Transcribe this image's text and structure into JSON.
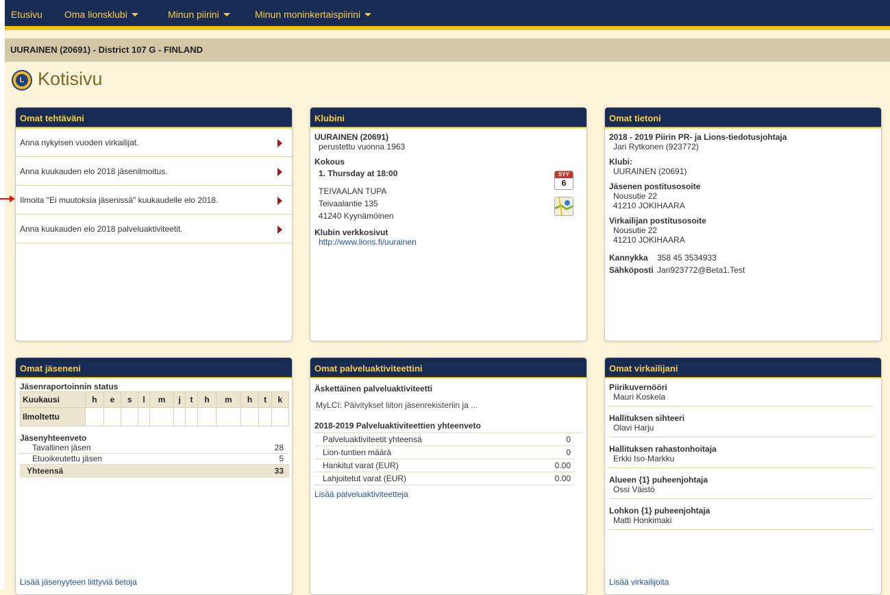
{
  "nav": {
    "items": [
      {
        "label": "Etusivu",
        "dropdown": false
      },
      {
        "label": "Oma lionsklubi",
        "dropdown": true
      },
      {
        "label": "Minun piirini",
        "dropdown": true
      },
      {
        "label": "Minun moninkertaispiirini",
        "dropdown": true
      }
    ]
  },
  "district_bar": "UURAINEN (20691) - District 107 G - FINLAND",
  "page_title": "Kotisivu",
  "tasks": {
    "title": "Omat tehtäväni",
    "items": [
      "Anna nykyisen vuoden virkailijat.",
      "Anna kuukauden elo 2018 jäsenilmoitus.",
      "Ilmoita \"Ei muutoksia jäsenissä\" kuukaudelle elo 2018.",
      "Anna kuukauden elo 2018 palveluaktiviteetit."
    ]
  },
  "club": {
    "title": "Klubini",
    "name": "UURAINEN (20691)",
    "founded": "perustettu vuonna 1963",
    "meeting_label": "Kokous",
    "meeting_time": "1. Thursday at 18:00",
    "venue": "TEIVAALAN TUPA",
    "street": "Teivaalantie 135",
    "city": "41240 Kyynämöinen",
    "website_label": "Klubin verkkosivut",
    "website_url": "http://www.lions.fi/uurainen",
    "calendar_month": "SYY",
    "calendar_day": "6"
  },
  "me": {
    "title": "Omat tietoni",
    "role": "2018 - 2019 Piirin PR- ja Lions-tiedotusjohtaja",
    "person": "Jari Rytkonen (923772)",
    "club_label": "Klubi:",
    "club_value": "UURAINEN (20691)",
    "member_addr_label": "Jäsenen postitusosoite",
    "member_addr_1": "Nousutie 22",
    "member_addr_2": "41210 JOKIHAARA",
    "officer_addr_label": "Virkailijan postitusosoite",
    "officer_addr_1": "Nousutie 22",
    "officer_addr_2": "41210 JOKIHAARA",
    "mobile_label": "Kannykka",
    "mobile_value": "358 45 3534933",
    "email_label": "Sähköposti",
    "email_value": "Jari923772@Beta1.Test"
  },
  "members": {
    "title": "Omat jäseneni",
    "report_status_label": "Jäsenraportoinnin status",
    "month_header": "Kuukausi",
    "months": [
      "h",
      "e",
      "s",
      "l",
      "m",
      "j",
      "t",
      "h",
      "m",
      "h",
      "t",
      "k"
    ],
    "reported_label": "Ilmoltettu",
    "summary_label": "Jäsenyhteenveto",
    "summary_rows": [
      {
        "label": "Tavallinen jäsen",
        "value": "28"
      },
      {
        "label": "Etuoikeutettu jäsen",
        "value": "5"
      }
    ],
    "total_label": "Yhteensä",
    "total_value": "33",
    "footer_link": "Lisää jäsenyyteen liittyviä tietoja"
  },
  "service": {
    "title": "Omat palveluaktiviteettini",
    "recent_label": "Äskettäinen palveluaktiviteetti",
    "recent_item": "MyLCI: Päivitykset liiton jäsenrekisteriin ja ...",
    "summary_label": "2018-2019 Palveluaktiviteettien yhteenveto",
    "rows": [
      {
        "label": "Palveluaktiviteetit yhteensä",
        "value": "0"
      },
      {
        "label": "Lion-tuntien määrä",
        "value": "0"
      },
      {
        "label": "Hankitut varat (EUR)",
        "value": "0.00"
      },
      {
        "label": "Lahjoitetut varat (EUR)",
        "value": "0.00"
      }
    ],
    "footer_link": "Lisää palveluaktiviteetteja"
  },
  "officers": {
    "title": "Omat virkailijani",
    "list": [
      {
        "role": "Piirikuvernööri",
        "name": "Mauri Koskela"
      },
      {
        "role": "Hallituksen sihteeri",
        "name": "Olavi Harju"
      },
      {
        "role": "Hallituksen rahastonhoitaja",
        "name": "Erkki Iso-Markku"
      },
      {
        "role": "Alueen {1} puheenjohtaja",
        "name": "Ossi Väistö"
      },
      {
        "role": "Lohkon {1} puheenjohtaja",
        "name": "Matti Honkimaki"
      }
    ],
    "footer_link": "Lisää virkailijoita"
  },
  "colors": {
    "nav_bg": "#182b54",
    "accent_yellow": "#f1c40f",
    "link_blue": "#1b56a8",
    "arrow_red": "#9b1c1c",
    "page_bg": "#fbf4d8"
  }
}
